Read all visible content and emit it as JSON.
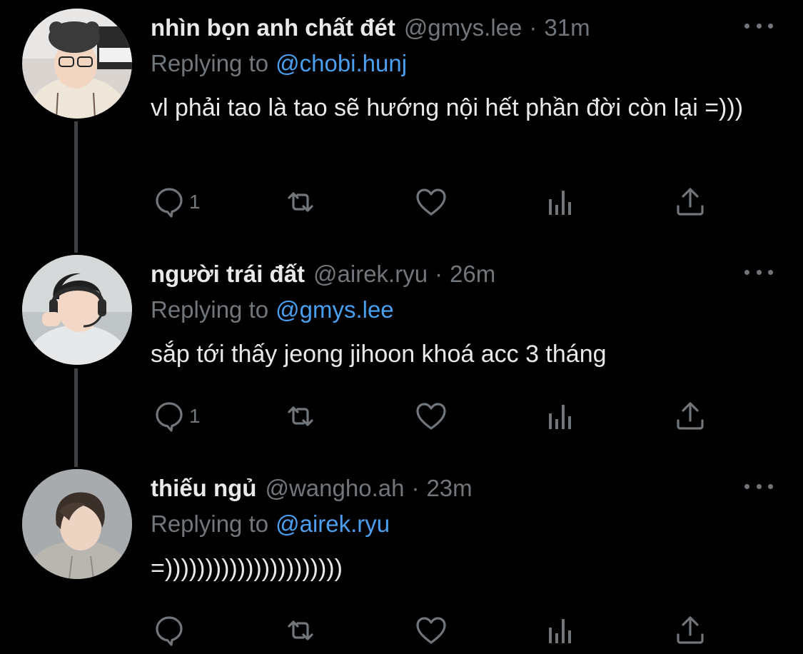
{
  "tweets": [
    {
      "name": "nhìn bọn anh chất đét",
      "handle": "@gmys.lee",
      "separator": "·",
      "time": "31m",
      "replying_prefix": "Replying to",
      "replying_to": "@chobi.hunj",
      "text": "vl phải tao là tao sẽ hướng nội hết phần đời còn lại =)))",
      "reply_count": "1"
    },
    {
      "name": "người trái đất",
      "handle": "@airek.ryu",
      "separator": "·",
      "time": "26m",
      "replying_prefix": "Replying to",
      "replying_to": "@gmys.lee",
      "text": "sắp tới thấy jeong jihoon khoá acc 3 tháng",
      "reply_count": "1"
    },
    {
      "name": "thiếu ngủ",
      "handle": "@wangho.ah",
      "separator": "·",
      "time": "23m",
      "replying_prefix": "Replying to",
      "replying_to": "@airek.ryu",
      "text": "=))))))))))))))))))))))",
      "reply_count": ""
    }
  ],
  "icons": {
    "reply": "reply-icon",
    "retweet": "retweet-icon",
    "like": "heart-icon",
    "views": "analytics-icon",
    "share": "share-icon",
    "more": "more-icon"
  },
  "colors": {
    "background": "#000000",
    "text": "#e7e9ea",
    "muted": "#71767b",
    "link": "#4a9ff0",
    "thread_line": "#3d4144"
  }
}
